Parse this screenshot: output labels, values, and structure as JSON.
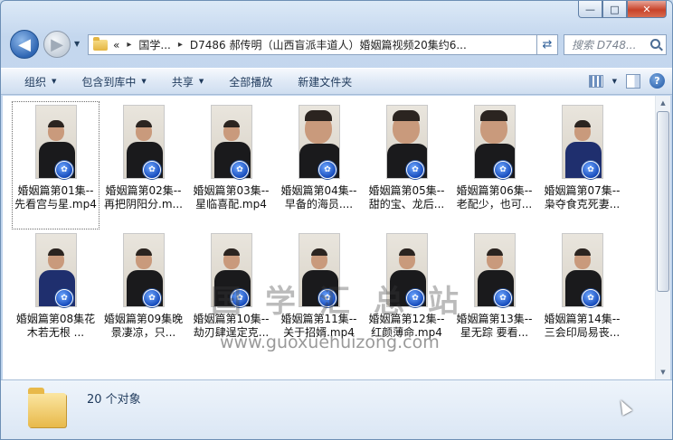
{
  "window": {
    "buttons": {
      "minimize": "—",
      "maximize": "□",
      "close": "✕"
    }
  },
  "nav": {
    "back_glyph": "◀",
    "forward_glyph": "▶",
    "breadcrumb": [
      "«",
      "国学...",
      "D7486 郝传明（山西盲派丰道人）婚姻篇视频20集约6..."
    ],
    "search_placeholder": "搜索 D748..."
  },
  "toolbar": {
    "items": [
      "组织",
      "包含到库中",
      "共享",
      "全部播放",
      "新建文件夹"
    ]
  },
  "files": [
    {
      "label": "婚姻篇第01集--先看宫与星.mp4",
      "thumb": "dark"
    },
    {
      "label": "婚姻篇第02集--再把阴阳分.m...",
      "thumb": "dark"
    },
    {
      "label": "婚姻篇第03集--星临喜配.mp4",
      "thumb": "dark"
    },
    {
      "label": "婚姻篇第04集--早备的海员....",
      "thumb": "close"
    },
    {
      "label": "婚姻篇第05集--甜的宝、龙后...",
      "thumb": "close"
    },
    {
      "label": "婚姻篇第06集--老配少，也可...",
      "thumb": "close"
    },
    {
      "label": "婚姻篇第07集--枭夺食克死妻...",
      "thumb": "blue"
    },
    {
      "label": "婚姻篇第08集花木若无根 ...",
      "thumb": "blue"
    },
    {
      "label": "婚姻篇第09集晚景凄凉，只...",
      "thumb": "dark"
    },
    {
      "label": "婚姻篇第10集--劫刃肆逞定克...",
      "thumb": "dark"
    },
    {
      "label": "婚姻篇第11集--关于招婿.mp4",
      "thumb": "dark"
    },
    {
      "label": "婚姻篇第12集--红颜薄命.mp4",
      "thumb": "dark"
    },
    {
      "label": "婚姻篇第13集--星无踪 要看...",
      "thumb": "dark"
    },
    {
      "label": "婚姻篇第14集--三会印局易丧...",
      "thumb": "dark"
    }
  ],
  "watermark": {
    "text": "国学汇总站",
    "url": "www.guoxuehuizong.com"
  },
  "details": {
    "count": "20 个对象"
  }
}
